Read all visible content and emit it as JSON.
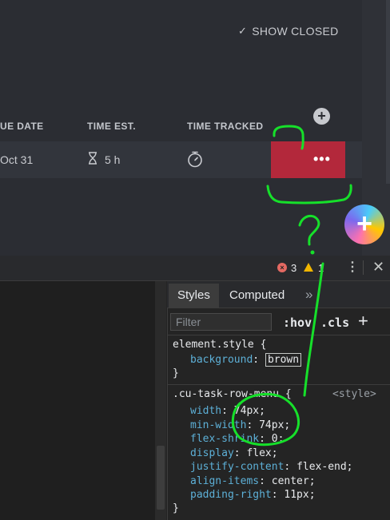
{
  "app": {
    "show_closed": "SHOW CLOSED",
    "headers": {
      "due_date": "UE DATE",
      "time_est": "TIME EST.",
      "time_tracked": "TIME TRACKED"
    },
    "row": {
      "due_date": "Oct 31",
      "time_est": "5 h",
      "menu_dots": "•••"
    },
    "add_column": "+",
    "fab": "+"
  },
  "devtools": {
    "errors": "3",
    "warnings": "1",
    "tabs": [
      "Styles",
      "Computed"
    ],
    "tabs_more": "»",
    "filter_placeholder": "Filter",
    "hov": ":hov",
    "cls": ".cls",
    "add": "+",
    "element_style": {
      "selector": "element.style {",
      "prop": "background",
      "value": "brown",
      "close": "}"
    },
    "rule": {
      "selector": ".cu-task-row-menu {",
      "source": "<style>",
      "decls": [
        {
          "prop": "width",
          "value": "74px;"
        },
        {
          "prop": "min-width",
          "value": "74px;"
        },
        {
          "prop": "flex-shrink",
          "value": "0;"
        },
        {
          "prop": "display",
          "value": "flex;"
        },
        {
          "prop": "justify-content",
          "value": "flex-end;"
        },
        {
          "prop": "align-items",
          "value": "center;"
        },
        {
          "prop": "padding-right",
          "value": "11px;"
        }
      ],
      "close": "}"
    }
  },
  "annotation": {
    "question_mark": "?",
    "color": "#16e02a"
  },
  "colors": {
    "menu_cell": "#b3283b",
    "app_bg": "#2b2d33"
  }
}
